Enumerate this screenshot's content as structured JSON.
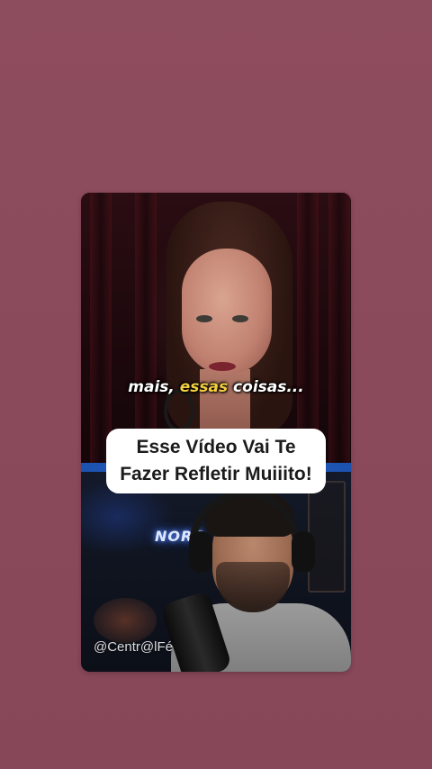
{
  "video": {
    "subtitle_pre": "mais, ",
    "subtitle_highlight": "essas",
    "subtitle_post": " coisas...",
    "title_line1": "Esse Vídeo Vai Te",
    "title_line2": "Fazer Refletir Muiiito!",
    "neon_sign": "NORE",
    "watermark": "@Centr@lFé"
  },
  "colors": {
    "background": "#8a4a5b",
    "subtitle_highlight": "#f2cf3e",
    "title_box": "#ffffff"
  }
}
